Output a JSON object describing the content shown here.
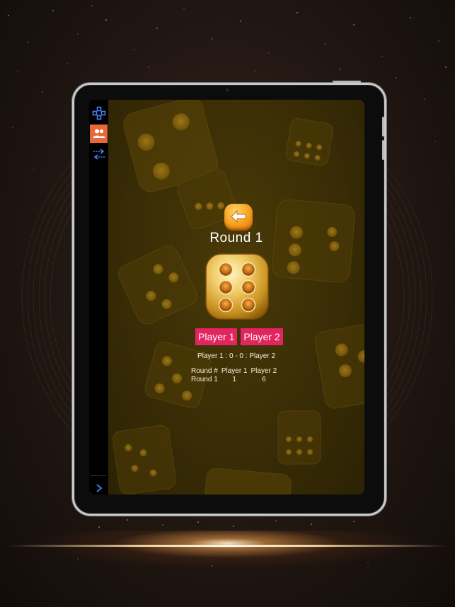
{
  "sidebar": {
    "items": [
      {
        "icon": "gamepad-icon",
        "active": false
      },
      {
        "icon": "players-icon",
        "active": true
      },
      {
        "icon": "swap-arrows-icon",
        "active": false
      }
    ],
    "expand_icon": "chevron-right-icon"
  },
  "game": {
    "back_icon": "arrow-left-icon",
    "round_title": "Round 1",
    "die_face": 6,
    "player_buttons": [
      "Player 1",
      "Player 2"
    ],
    "score_line": "Player 1 : 0 - 0 : Player 2",
    "results": {
      "headers": [
        "Round #",
        "Player 1",
        "Player 2"
      ],
      "rows": [
        [
          "Round 1",
          "1",
          "6"
        ]
      ]
    }
  },
  "colors": {
    "accent": "#e2245f",
    "sidebar_active": "#e8683a",
    "back_button": "#f6a11d",
    "game_bg": "#3a2d06",
    "die_gold": "#e9c25a"
  }
}
